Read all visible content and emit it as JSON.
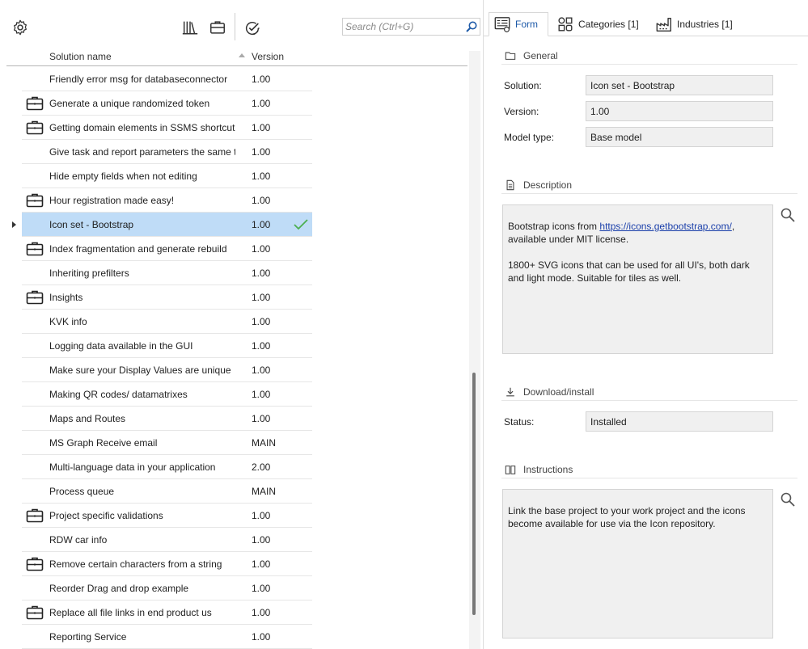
{
  "toolbar": {
    "settings_icon": "gear-icon",
    "library_icon": "library-books-icon",
    "toolbox_icon": "briefcase-icon",
    "validate_icon": "gear-check-icon"
  },
  "search": {
    "placeholder": "Search (Ctrl+G)",
    "value": ""
  },
  "grid": {
    "columns": {
      "name": "Solution name",
      "version": "Version"
    },
    "sort": "ascending",
    "selected_index": 6,
    "rows": [
      {
        "name": "Friendly error msg for databaseconnector",
        "version": "1.00",
        "icon": false
      },
      {
        "name": "Generate a unique randomized token",
        "version": "1.00",
        "icon": true
      },
      {
        "name": "Getting domain elements in SSMS shortcut",
        "version": "1.00",
        "icon": true
      },
      {
        "name": "Give task and report parameters the same tr",
        "version": "1.00",
        "icon": false
      },
      {
        "name": "Hide empty fields when not editing",
        "version": "1.00",
        "icon": false
      },
      {
        "name": "Hour registration made easy!",
        "version": "1.00",
        "icon": true
      },
      {
        "name": "Icon set - Bootstrap",
        "version": "1.00",
        "icon": false,
        "installed": true
      },
      {
        "name": "Index fragmentation and generate rebuild",
        "version": "1.00",
        "icon": true
      },
      {
        "name": "Inheriting prefilters",
        "version": "1.00",
        "icon": false
      },
      {
        "name": "Insights",
        "version": "1.00",
        "icon": true
      },
      {
        "name": "KVK info",
        "version": "1.00",
        "icon": false
      },
      {
        "name": "Logging data available in the GUI",
        "version": "1.00",
        "icon": false
      },
      {
        "name": "Make sure your Display Values are unique",
        "version": "1.00",
        "icon": false
      },
      {
        "name": "Making QR codes/ datamatrixes",
        "version": "1.00",
        "icon": false
      },
      {
        "name": "Maps and Routes",
        "version": "1.00",
        "icon": false
      },
      {
        "name": "MS Graph Receive email",
        "version": "MAIN",
        "icon": false
      },
      {
        "name": "Multi-language data in your application",
        "version": "2.00",
        "icon": false
      },
      {
        "name": "Process queue",
        "version": "MAIN",
        "icon": false
      },
      {
        "name": "Project specific validations",
        "version": "1.00",
        "icon": true
      },
      {
        "name": "RDW car info",
        "version": "1.00",
        "icon": false
      },
      {
        "name": "Remove certain characters from a string",
        "version": "1.00",
        "icon": true
      },
      {
        "name": "Reorder Drag and drop example",
        "version": "1.00",
        "icon": false
      },
      {
        "name": "Replace all file links in end product us",
        "version": "1.00",
        "icon": true
      },
      {
        "name": "Reporting Service",
        "version": "1.00",
        "icon": false
      }
    ]
  },
  "tabs": [
    {
      "label": "Form",
      "icon": "form-icon",
      "active": true
    },
    {
      "label": "Categories [1]",
      "icon": "categories-icon",
      "active": false
    },
    {
      "label": "Industries [1]",
      "icon": "factory-icon",
      "active": false
    }
  ],
  "form": {
    "general": {
      "title": "General",
      "solution_label": "Solution:",
      "solution_value": "Icon set - Bootstrap",
      "version_label": "Version:",
      "version_value": "1.00",
      "model_type_label": "Model type:",
      "model_type_value": "Base model"
    },
    "description": {
      "title": "Description",
      "text_before_link": "Bootstrap icons from ",
      "link": "https://icons.getbootstrap.com/",
      "text_after_link": ", available under MIT license.",
      "paragraph2": "1800+ SVG icons that can be used for all UI's, both dark and light mode. Suitable for tiles as well."
    },
    "download": {
      "title": "Download/install",
      "status_label": "Status:",
      "status_value": "Installed"
    },
    "instructions": {
      "title": "Instructions",
      "text": "Link the base project to your work project and the icons become available for use via the Icon repository."
    }
  },
  "colors": {
    "selection": "#bfdcf7",
    "check": "#4caf50",
    "active_tab_text": "#1e5aa8",
    "field_bg": "#f0f0f0"
  }
}
